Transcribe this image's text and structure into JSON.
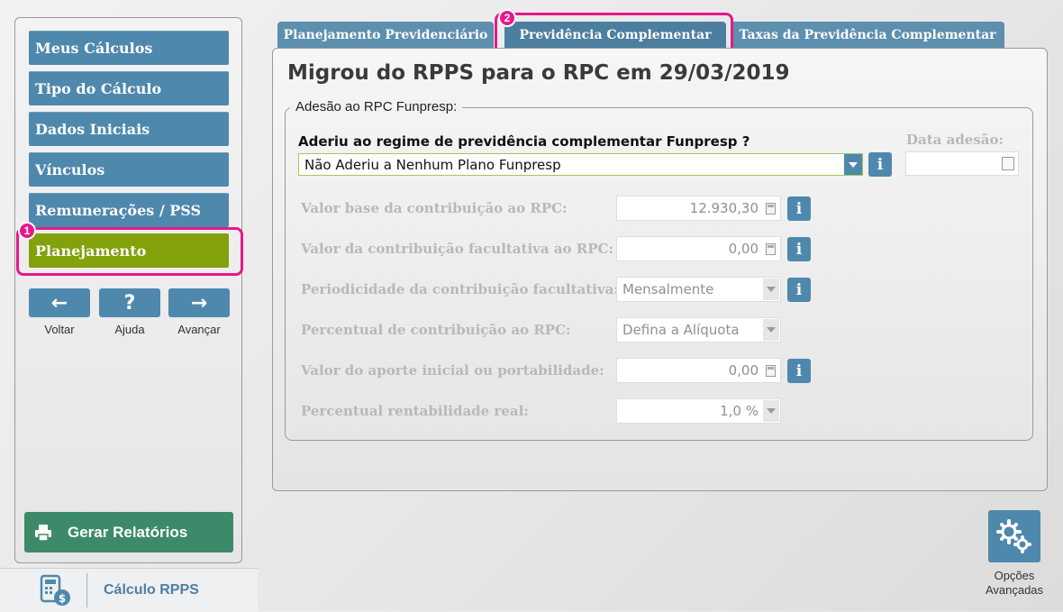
{
  "nav": {
    "items": [
      {
        "label": "Meus Cálculos"
      },
      {
        "label": "Tipo do Cálculo"
      },
      {
        "label": "Dados Iniciais"
      },
      {
        "label": "Vínculos"
      },
      {
        "label": "Remunerações / PSS"
      },
      {
        "label": "Planejamento",
        "active": true
      }
    ],
    "buttons": [
      {
        "glyph": "←",
        "label": "Voltar"
      },
      {
        "glyph": "?",
        "label": "Ajuda"
      },
      {
        "glyph": "→",
        "label": "Avançar"
      }
    ],
    "gerar_label": "Gerar Relatórios",
    "app_name": "Cálculo RPPS"
  },
  "annotations": {
    "badge1": "1",
    "badge2": "2"
  },
  "tabs": [
    {
      "label": "Planejamento Previdenciário"
    },
    {
      "label": "Previdência Complementar",
      "active": true
    },
    {
      "label": "Taxas da Previdência Complementar"
    }
  ],
  "main": {
    "title": "Migrou do RPPS para o RPC em 29/03/2019",
    "fieldset_legend": "Adesão ao RPC Funpresp:",
    "aderiu_label": "Aderiu ao regime de previdência complementar Funpresp ?",
    "aderiu_value": "Não Aderiu a Nenhum Plano Funpresp",
    "data_adesao_label": "Data adesão:",
    "data_adesao_value": "",
    "info_glyph": "i",
    "fields": [
      {
        "label": "Valor base da contribuição ao RPC:",
        "value": "12.930,30"
      },
      {
        "label": "Valor da contribuição facultativa ao RPC:",
        "value": "0,00"
      },
      {
        "label": "Periodicidade da contribuição facultativa:",
        "value": "Mensalmente"
      },
      {
        "label": "Percentual de contribuição ao RPC:",
        "value": "Defina a Alíquota"
      },
      {
        "label": "Valor do aporte inicial ou portabilidade:",
        "value": "0,00"
      },
      {
        "label": "Percentual rentabilidade real:",
        "value": "1,0 %"
      }
    ]
  },
  "opcoes": {
    "line1": "Opções",
    "line2": "Avançadas"
  },
  "colors": {
    "accent": "#4f88ad",
    "active_nav": "#83a10a",
    "highlight": "#e6198b",
    "report_button": "#3d8a6a"
  }
}
